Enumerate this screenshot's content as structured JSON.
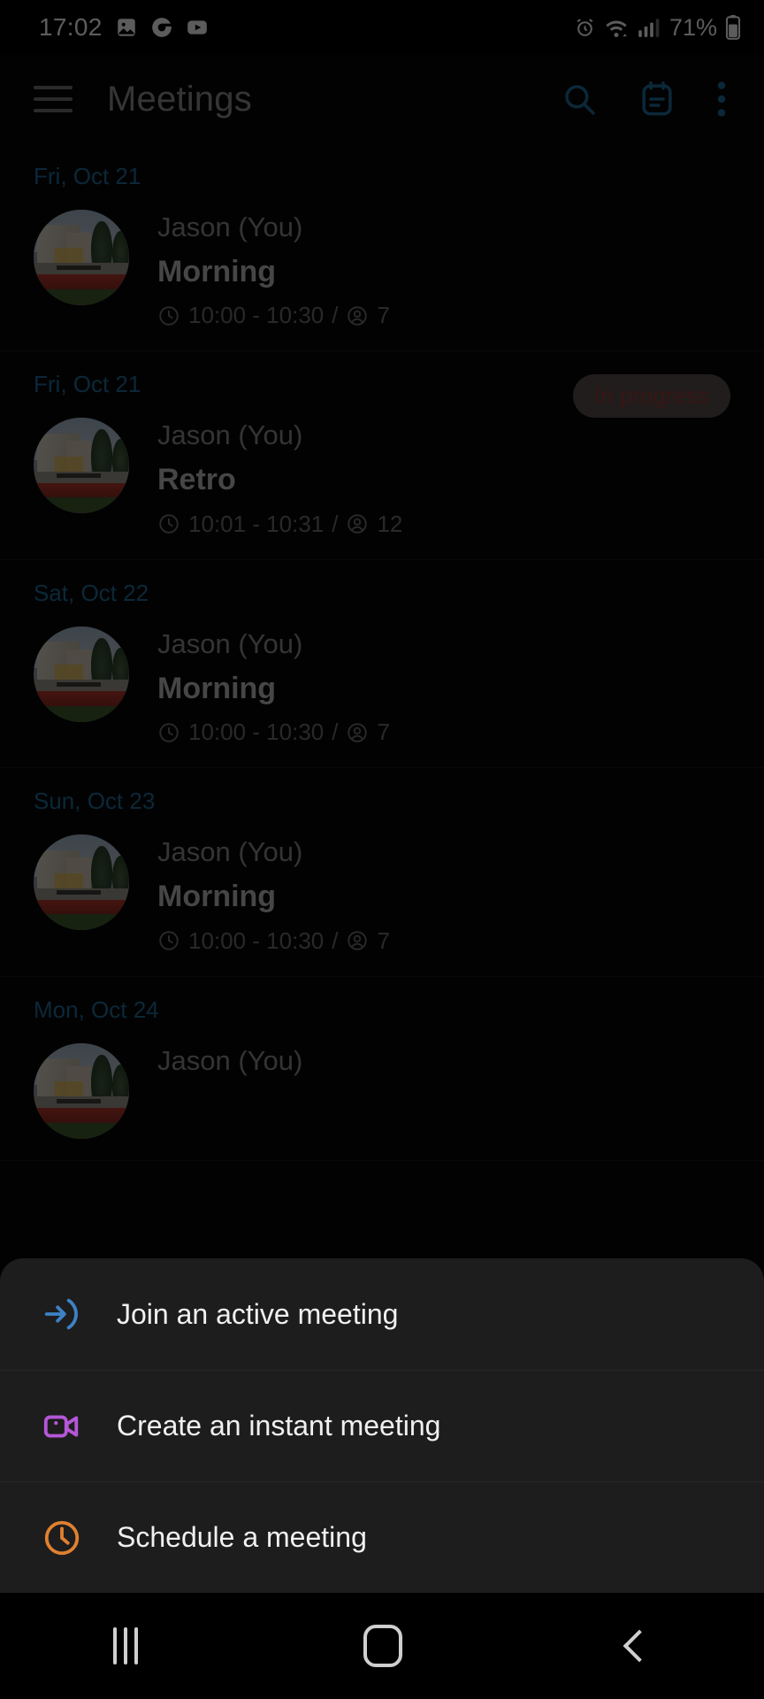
{
  "status_bar": {
    "time": "17:02",
    "battery_percent": "71%",
    "left_icons": [
      "gallery-icon",
      "chrome-icon",
      "youtube-icon"
    ],
    "right_icons": [
      "alarm-icon",
      "wifi-icon",
      "signal-icon",
      "battery-icon"
    ]
  },
  "app_bar": {
    "title": "Meetings",
    "menu_icon": "hamburger-icon",
    "actions": [
      "search-icon",
      "calendar-icon",
      "overflow-menu-icon"
    ],
    "accent_color": "#1f6b96"
  },
  "meetings": [
    {
      "date": "Fri, Oct 21",
      "organizer": "Jason (You)",
      "title": "Morning",
      "time": "10:00 - 10:30",
      "participants": "7",
      "separator": "/",
      "status": ""
    },
    {
      "date": "Fri, Oct 21",
      "organizer": "Jason (You)",
      "title": "Retro",
      "time": "10:01 - 10:31",
      "participants": "12",
      "separator": "/",
      "status": "In progress"
    },
    {
      "date": "Sat, Oct 22",
      "organizer": "Jason (You)",
      "title": "Morning",
      "time": "10:00 - 10:30",
      "participants": "7",
      "separator": "/",
      "status": ""
    },
    {
      "date": "Sun, Oct 23",
      "organizer": "Jason (You)",
      "title": "Morning",
      "time": "10:00 - 10:30",
      "participants": "7",
      "separator": "/",
      "status": ""
    },
    {
      "date": "Mon, Oct 24",
      "organizer": "Jason (You)",
      "title": "",
      "time": "",
      "participants": "",
      "separator": "",
      "status": ""
    }
  ],
  "bottom_sheet": {
    "items": [
      {
        "label": "Join an active meeting",
        "icon": "login-arrow-icon",
        "color": "#3d82c4"
      },
      {
        "label": "Create an instant meeting",
        "icon": "video-camera-icon",
        "color": "#b457d8"
      },
      {
        "label": "Schedule a meeting",
        "icon": "clock-icon",
        "color": "#e08030"
      }
    ]
  },
  "nav_bar": {
    "recents_label": "recents-button",
    "home_label": "home-button",
    "back_label": "back-button"
  }
}
